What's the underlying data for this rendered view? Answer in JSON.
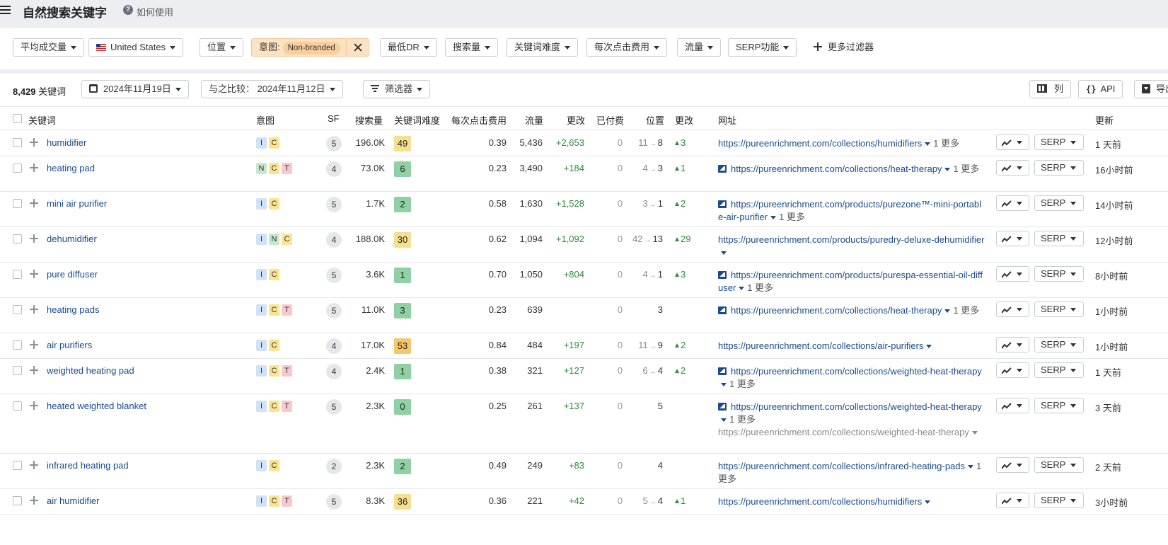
{
  "header": {
    "title": "自然搜索关键字",
    "help_label": "如何使用"
  },
  "filters": {
    "avg_volume": "平均成交量",
    "country": "United States",
    "position": "位置",
    "intent_label": "意图:",
    "intent_value": "Non-branded",
    "min_dr": "最低DR",
    "volume": "搜索量",
    "kd": "关键词难度",
    "cpc": "每次点击费用",
    "traffic": "流量",
    "serp_features": "SERP功能",
    "more": "更多过滤器"
  },
  "toolbar": {
    "count": "8,429",
    "count_label": "关键词",
    "date": "2024年11月19日",
    "compare": "与之比较： 2024年11月12日",
    "filters_btn": "筛选器",
    "columns_btn": "列",
    "api_btn": "API",
    "export_btn": "导出"
  },
  "columns": {
    "keyword": "关键词",
    "intent": "意图",
    "sf": "SF",
    "volume": "搜索量",
    "kd": "关键词难度",
    "cpc": "每次点击费用",
    "traffic": "流量",
    "change": "更改",
    "paid": "已付费",
    "position": "位置",
    "pos_change": "更改",
    "url": "网址",
    "updated": "更新"
  },
  "colors": {
    "kd_green": "#8fd1a5",
    "kd_yellow": "#f4e08f",
    "kd_orange": "#f6c76a",
    "link": "#1a4b8c",
    "positive": "#2e8b3e"
  },
  "rows": [
    {
      "kw": "humidifier",
      "intents": [
        "I",
        "C"
      ],
      "sf": "5",
      "vol": "196.0K",
      "kd": "49",
      "kdc": "#f4e08f",
      "cpc": "0.39",
      "traffic": "5,436",
      "chg": "+2,653",
      "paid": "0",
      "pos_old": "11",
      "pos": "8",
      "pchg": "3",
      "img": false,
      "url": "https://pureenrichment.com/collections/humidifiers",
      "more": "1 更多",
      "second": "",
      "upd": "1 天前",
      "h": 36
    },
    {
      "kw": "heating pad",
      "intents": [
        "N",
        "C",
        "T"
      ],
      "sf": "4",
      "vol": "73.0K",
      "kd": "6",
      "kdc": "#8fd1a5",
      "cpc": "0.23",
      "traffic": "3,490",
      "chg": "+184",
      "paid": "0",
      "pos_old": "4",
      "pos": "3",
      "pchg": "1",
      "img": true,
      "url": "https://pureenrichment.com/collections/heat-therapy",
      "more": "1 更多",
      "second": "",
      "upd": "16小时前",
      "h": 50
    },
    {
      "kw": "mini air purifier",
      "intents": [
        "I",
        "C"
      ],
      "sf": "5",
      "vol": "1.7K",
      "kd": "2",
      "kdc": "#8fd1a5",
      "cpc": "0.58",
      "traffic": "1,630",
      "chg": "+1,528",
      "paid": "0",
      "pos_old": "3",
      "pos": "1",
      "pchg": "2",
      "img": true,
      "url": "https://pureenrichment.com/products/purezone™-mini-portable-air-purifier",
      "more": "1 更多",
      "second": "",
      "upd": "14小时前",
      "h": 50
    },
    {
      "kw": "dehumidifier",
      "intents": [
        "I",
        "N",
        "C"
      ],
      "sf": "4",
      "vol": "188.0K",
      "kd": "30",
      "kdc": "#f4e08f",
      "cpc": "0.62",
      "traffic": "1,094",
      "chg": "+1,092",
      "paid": "0",
      "pos_old": "42",
      "pos": "13",
      "pchg": "29",
      "img": false,
      "url": "https://pureenrichment.com/products/puredry-deluxe-dehumidifier",
      "more": "",
      "second": "",
      "upd": "12小时前",
      "h": 50
    },
    {
      "kw": "pure diffuser",
      "intents": [
        "I",
        "C"
      ],
      "sf": "5",
      "vol": "3.6K",
      "kd": "1",
      "kdc": "#8fd1a5",
      "cpc": "0.70",
      "traffic": "1,050",
      "chg": "+804",
      "paid": "0",
      "pos_old": "4",
      "pos": "1",
      "pchg": "3",
      "img": true,
      "url": "https://pureenrichment.com/products/purespa-essential-oil-diffuser",
      "more": "1 更多",
      "second": "",
      "upd": "8小时前",
      "h": 50
    },
    {
      "kw": "heating pads",
      "intents": [
        "I",
        "C",
        "T"
      ],
      "sf": "5",
      "vol": "11.0K",
      "kd": "3",
      "kdc": "#8fd1a5",
      "cpc": "0.23",
      "traffic": "639",
      "chg": "",
      "paid": "0",
      "pos_old": "",
      "pos": "3",
      "pchg": "",
      "img": true,
      "url": "https://pureenrichment.com/collections/heat-therapy",
      "more": "1 更多",
      "second": "",
      "upd": "1小时前",
      "h": 50
    },
    {
      "kw": "air purifiers",
      "intents": [
        "I",
        "C"
      ],
      "sf": "4",
      "vol": "17.0K",
      "kd": "53",
      "kdc": "#f6c76a",
      "cpc": "0.84",
      "traffic": "484",
      "chg": "+197",
      "paid": "0",
      "pos_old": "11",
      "pos": "9",
      "pchg": "2",
      "img": false,
      "url": "https://pureenrichment.com/collections/air-purifiers",
      "more": "",
      "second": "",
      "upd": "1小时前",
      "h": 36
    },
    {
      "kw": "weighted heating pad",
      "intents": [
        "I",
        "C",
        "T"
      ],
      "sf": "4",
      "vol": "2.4K",
      "kd": "1",
      "kdc": "#8fd1a5",
      "cpc": "0.38",
      "traffic": "321",
      "chg": "+127",
      "paid": "0",
      "pos_old": "6",
      "pos": "4",
      "pchg": "2",
      "img": true,
      "url": "https://pureenrichment.com/collections/weighted-heat-therapy",
      "more": "1 更多",
      "second": "",
      "upd": "1 天前",
      "h": 50
    },
    {
      "kw": "heated weighted blanket",
      "intents": [
        "I",
        "C",
        "T"
      ],
      "sf": "5",
      "vol": "2.3K",
      "kd": "0",
      "kdc": "#8fd1a5",
      "cpc": "0.25",
      "traffic": "261",
      "chg": "+137",
      "paid": "0",
      "pos_old": "",
      "pos": "5",
      "pchg": "",
      "img": true,
      "url": "https://pureenrichment.com/collections/weighted-heat-therapy",
      "more": "1 更多",
      "second": "https://pureenrichment.com/collections/weighted-heat-therapy",
      "upd": "3 天前",
      "h": 84
    },
    {
      "kw": "infrared heating pad",
      "intents": [
        "I",
        "C"
      ],
      "sf": "2",
      "vol": "2.3K",
      "kd": "2",
      "kdc": "#8fd1a5",
      "cpc": "0.49",
      "traffic": "249",
      "chg": "+83",
      "paid": "0",
      "pos_old": "",
      "pos": "4",
      "pchg": "",
      "img": false,
      "url": "https://pureenrichment.com/collections/infrared-heating-pads",
      "more": "1 更多",
      "second": "",
      "upd": "2 天前",
      "h": 50
    },
    {
      "kw": "air humidifier",
      "intents": [
        "I",
        "C",
        "T"
      ],
      "sf": "5",
      "vol": "8.3K",
      "kd": "36",
      "kdc": "#f4e08f",
      "cpc": "0.36",
      "traffic": "221",
      "chg": "+42",
      "paid": "0",
      "pos_old": "5",
      "pos": "4",
      "pchg": "1",
      "img": false,
      "url": "https://pureenrichment.com/collections/humidifiers",
      "more": "",
      "second": "",
      "upd": "3小时前",
      "h": 36
    }
  ]
}
